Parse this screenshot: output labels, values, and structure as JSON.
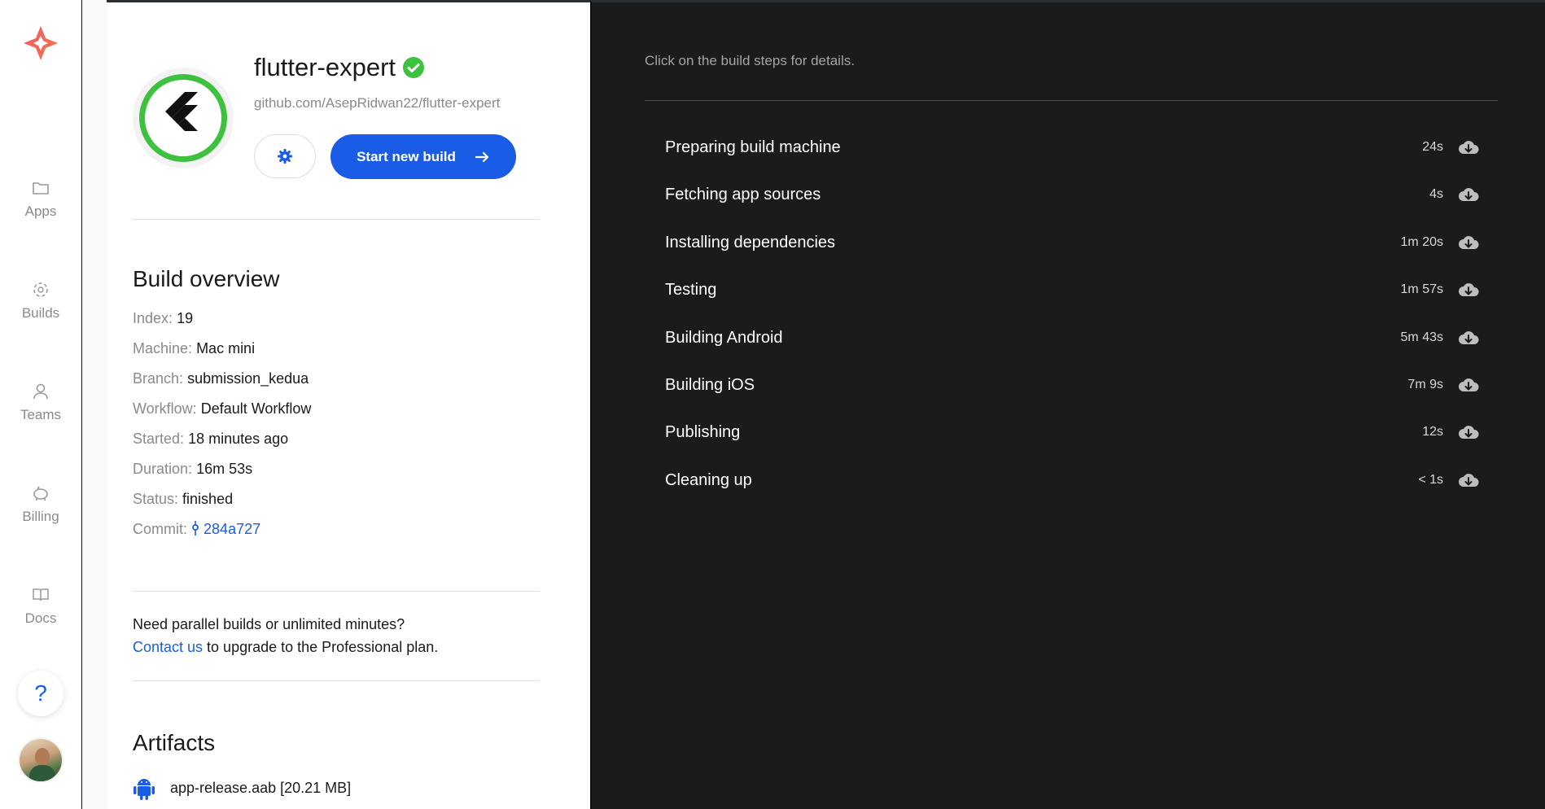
{
  "sidebar": {
    "items": [
      {
        "label": "Apps",
        "icon": "folder-icon"
      },
      {
        "label": "Builds",
        "icon": "builds-icon"
      },
      {
        "label": "Teams",
        "icon": "user-icon"
      },
      {
        "label": "Billing",
        "icon": "piggy-bank-icon"
      },
      {
        "label": "Docs",
        "icon": "book-icon"
      }
    ],
    "help_label": "?"
  },
  "app": {
    "name": "flutter-expert",
    "repo": "github.com/AsepRidwan22/flutter-expert",
    "start_button": "Start new build"
  },
  "overview": {
    "title": "Build overview",
    "index_label": "Index:",
    "index_value": "19",
    "machine_label": "Machine:",
    "machine_value": "Mac mini",
    "branch_label": "Branch:",
    "branch_value": "submission_kedua",
    "workflow_label": "Workflow:",
    "workflow_value": "Default Workflow",
    "started_label": "Started:",
    "started_value": "18 minutes ago",
    "duration_label": "Duration:",
    "duration_value": "16m 53s",
    "status_label": "Status:",
    "status_value": "finished",
    "commit_label": "Commit:",
    "commit_value": "284a727"
  },
  "upgrade": {
    "line1": "Need parallel builds or unlimited minutes?",
    "link": "Contact us",
    "line2_rest": " to upgrade to the Professional plan."
  },
  "artifacts": {
    "title": "Artifacts",
    "items": [
      {
        "name": "app-release.aab [20.21 MB]"
      }
    ]
  },
  "build_log": {
    "hint": "Click on the build steps for details.",
    "steps": [
      {
        "name": "Preparing build machine",
        "duration": "24s"
      },
      {
        "name": "Fetching app sources",
        "duration": "4s"
      },
      {
        "name": "Installing dependencies",
        "duration": "1m 20s"
      },
      {
        "name": "Testing",
        "duration": "1m 57s"
      },
      {
        "name": "Building Android",
        "duration": "5m 43s"
      },
      {
        "name": "Building iOS",
        "duration": "7m 9s"
      },
      {
        "name": "Publishing",
        "duration": "12s"
      },
      {
        "name": "Cleaning up",
        "duration": "< 1s"
      }
    ]
  },
  "colors": {
    "accent": "#1a5ce6",
    "verified": "#3ec13e",
    "dark_bg": "#1b1b1b",
    "muted": "#8a8a8a"
  }
}
